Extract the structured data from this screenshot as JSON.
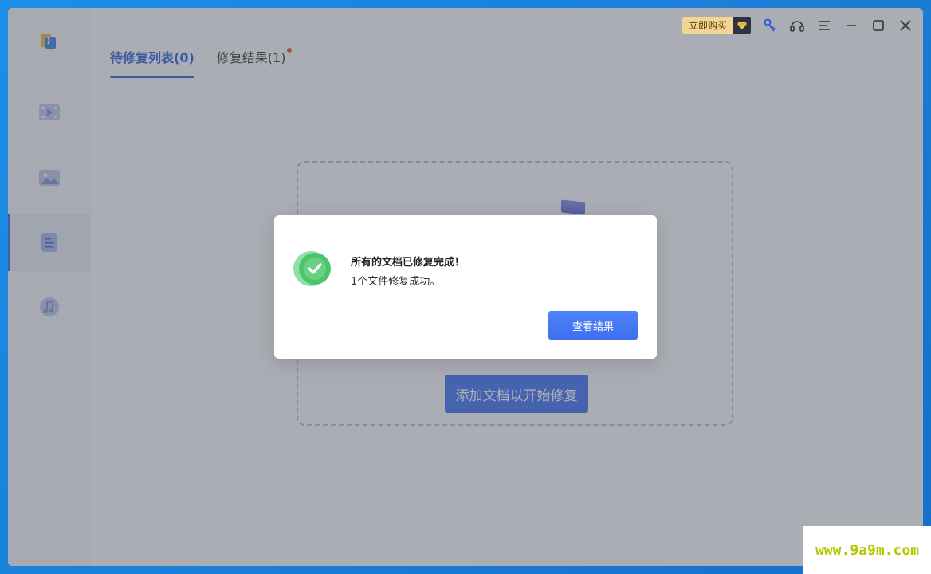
{
  "topbar": {
    "buy_label": "立即购买"
  },
  "tabs": [
    {
      "label": "待修复列表(0)",
      "active": true
    },
    {
      "label": "修复结果(1)",
      "active": false
    }
  ],
  "sidebar": {
    "items": [
      {
        "name": "video",
        "icon": "video-icon"
      },
      {
        "name": "photo",
        "icon": "image-icon"
      },
      {
        "name": "document",
        "icon": "document-icon",
        "active": true
      },
      {
        "name": "audio",
        "icon": "music-icon"
      }
    ]
  },
  "main": {
    "add_button_label": "添加文档以开始修复"
  },
  "dialog": {
    "title": "所有的文档已修复完成！",
    "message": "1个文件修复成功。",
    "button_label": "查看结果"
  },
  "watermark": {
    "text": "www.9a9m.com"
  },
  "colors": {
    "accent": "#3e6ff0",
    "success": "#4cc46a",
    "badge_dot": "#e8553a"
  }
}
